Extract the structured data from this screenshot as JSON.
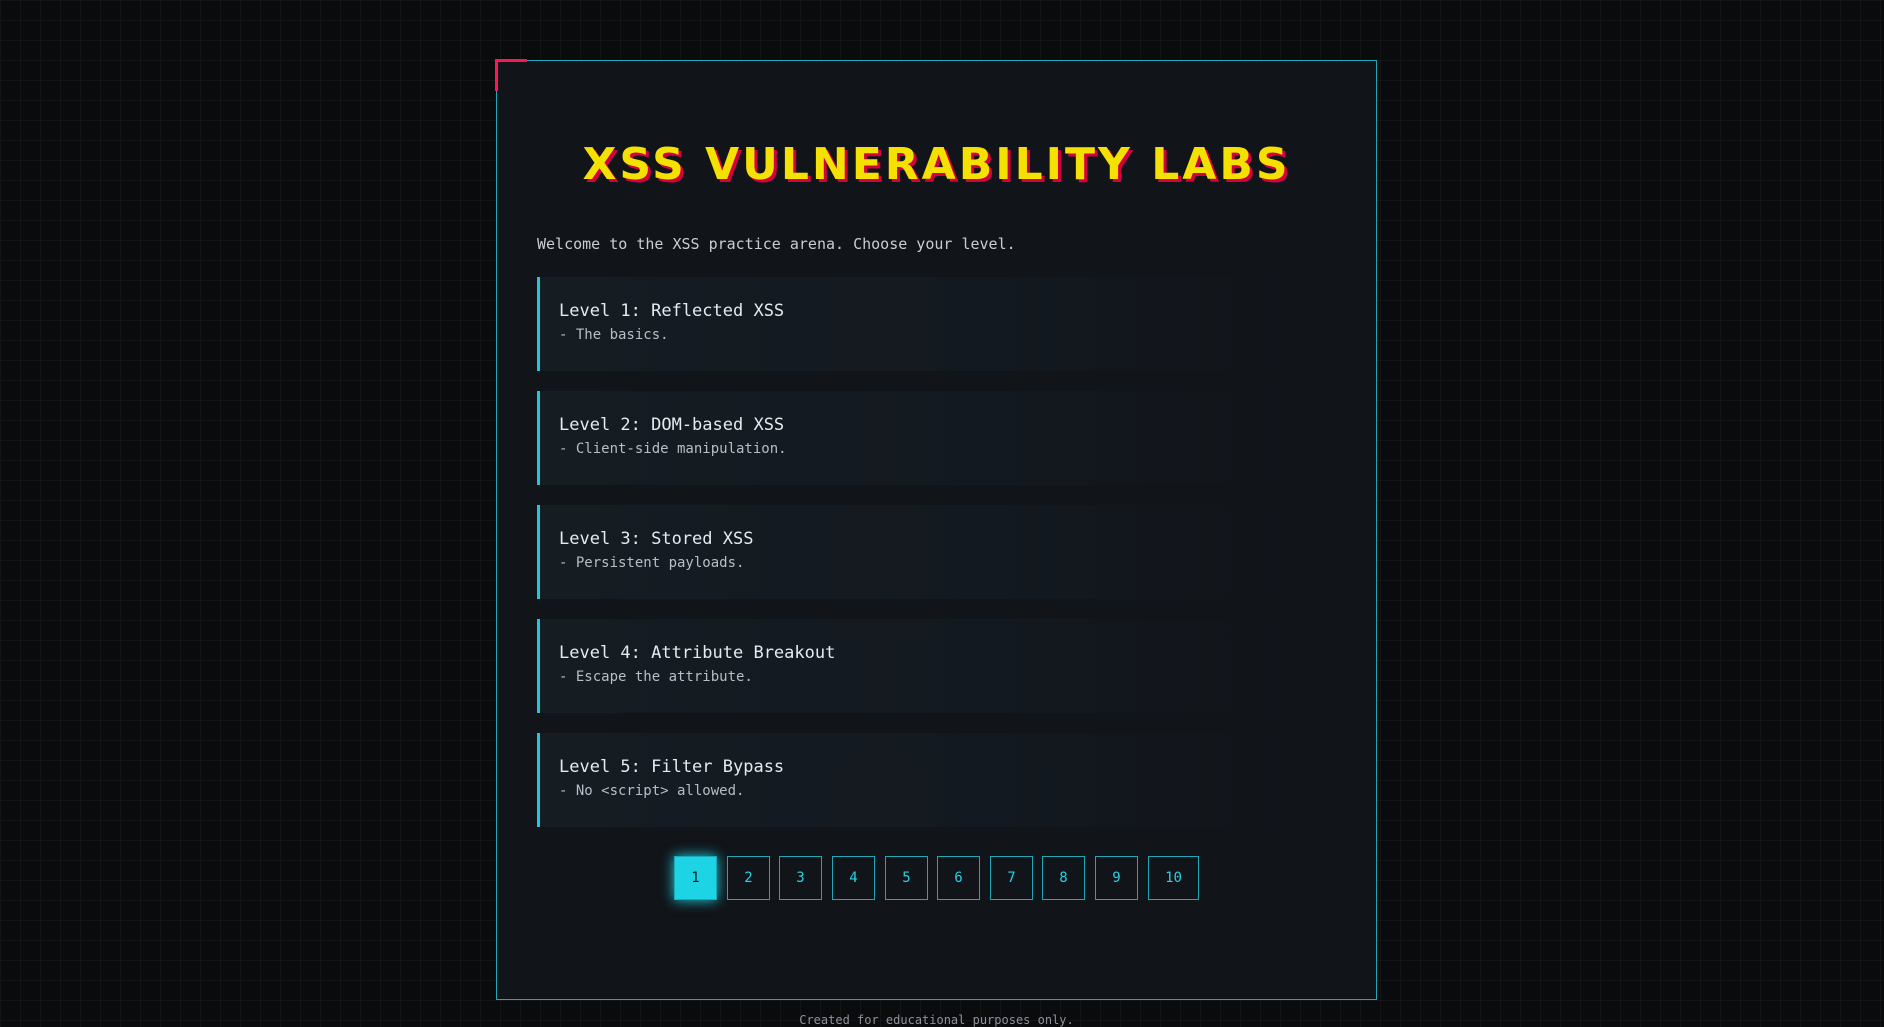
{
  "header": {
    "title": "XSS VULNERABILITY LABS"
  },
  "intro": "Welcome to the XSS practice arena. Choose your level.",
  "levels": [
    {
      "title": "Level 1: Reflected XSS",
      "desc": "- The basics."
    },
    {
      "title": "Level 2: DOM-based XSS",
      "desc": "- Client-side manipulation."
    },
    {
      "title": "Level 3: Stored XSS",
      "desc": "- Persistent payloads."
    },
    {
      "title": "Level 4: Attribute Breakout",
      "desc": "- Escape the attribute."
    },
    {
      "title": "Level 5: Filter Bypass",
      "desc": "- No <script> allowed."
    }
  ],
  "pagination": {
    "current": 1,
    "pages": [
      "1",
      "2",
      "3",
      "4",
      "5",
      "6",
      "7",
      "8",
      "9",
      "10"
    ]
  },
  "footer": "Created for educational purposes only.",
  "colors": {
    "accent": "#1ec8dc",
    "title": "#f5e100",
    "title_shadow": "#d4003f",
    "corner": "#ff1454"
  }
}
